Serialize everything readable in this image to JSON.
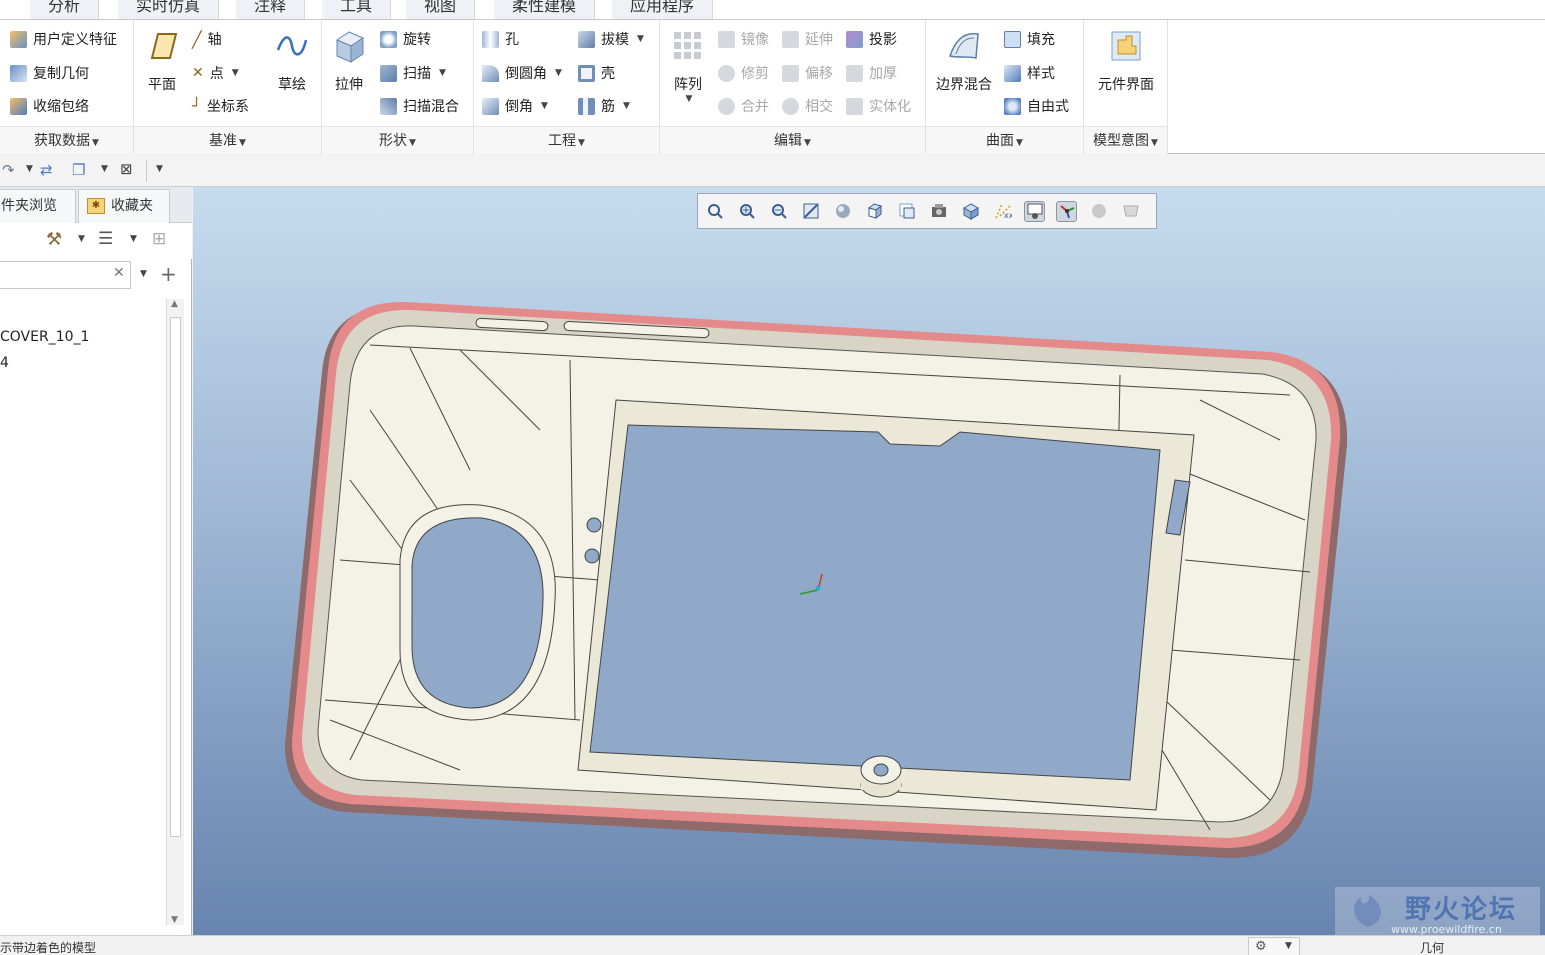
{
  "menu_tabs": [
    "分析",
    "实时仿真",
    "注释",
    "工具",
    "视图",
    "柔性建模",
    "应用程序"
  ],
  "ribbon": {
    "get_data": {
      "label": "获取数据",
      "items": [
        "用户定义特征",
        "复制几何",
        "收缩包络"
      ]
    },
    "datum": {
      "label": "基准",
      "plane": "平面",
      "items": [
        "轴",
        "点",
        "坐标系"
      ],
      "sketch": "草绘"
    },
    "shapes": {
      "label": "形状",
      "extrude": "拉伸",
      "items": [
        "旋转",
        "扫描",
        "扫描混合"
      ]
    },
    "engineering": {
      "label": "工程",
      "col1": [
        "孔",
        "倒圆角",
        "倒角"
      ],
      "col2": [
        "拔模",
        "壳",
        "筋"
      ]
    },
    "editing": {
      "label": "编辑",
      "pattern": "阵列",
      "col1": [
        "镜像",
        "修剪",
        "合并"
      ],
      "col2": [
        "延伸",
        "偏移",
        "相交"
      ],
      "col3": [
        "投影",
        "加厚",
        "实体化"
      ]
    },
    "surfaces": {
      "label": "曲面",
      "boundary_blend": "边界混合",
      "items": [
        "填充",
        "样式",
        "自由式"
      ]
    },
    "model_intent": {
      "label": "模型意图",
      "component_interface": "元件界面"
    }
  },
  "panel": {
    "tabs": [
      "件夹浏览器",
      "收藏夹"
    ],
    "tree": [
      "COVER_10_1",
      "4"
    ]
  },
  "viewport": {
    "toolbar_icons": [
      "refit-icon",
      "zoom-in-icon",
      "zoom-out-icon",
      "repaint-icon",
      "display-style-icon",
      "saved-orientations-icon",
      "named-views-icon",
      "view-manager-icon",
      "perspective-icon",
      "datum-display-icon",
      "annotation-display-icon",
      "spin-center-icon",
      "appearance-icon",
      "section-icon"
    ]
  },
  "watermark": {
    "text": "野火论坛",
    "url": "www.proewildfire.cn"
  },
  "status": {
    "message": "示带边着色的模型",
    "filter": "几何"
  },
  "colors": {
    "viewport_top": "#c6dcee",
    "viewport_bottom": "#6885b0",
    "model_body": "#f4f2e6",
    "model_edge": "#e58a8a"
  }
}
